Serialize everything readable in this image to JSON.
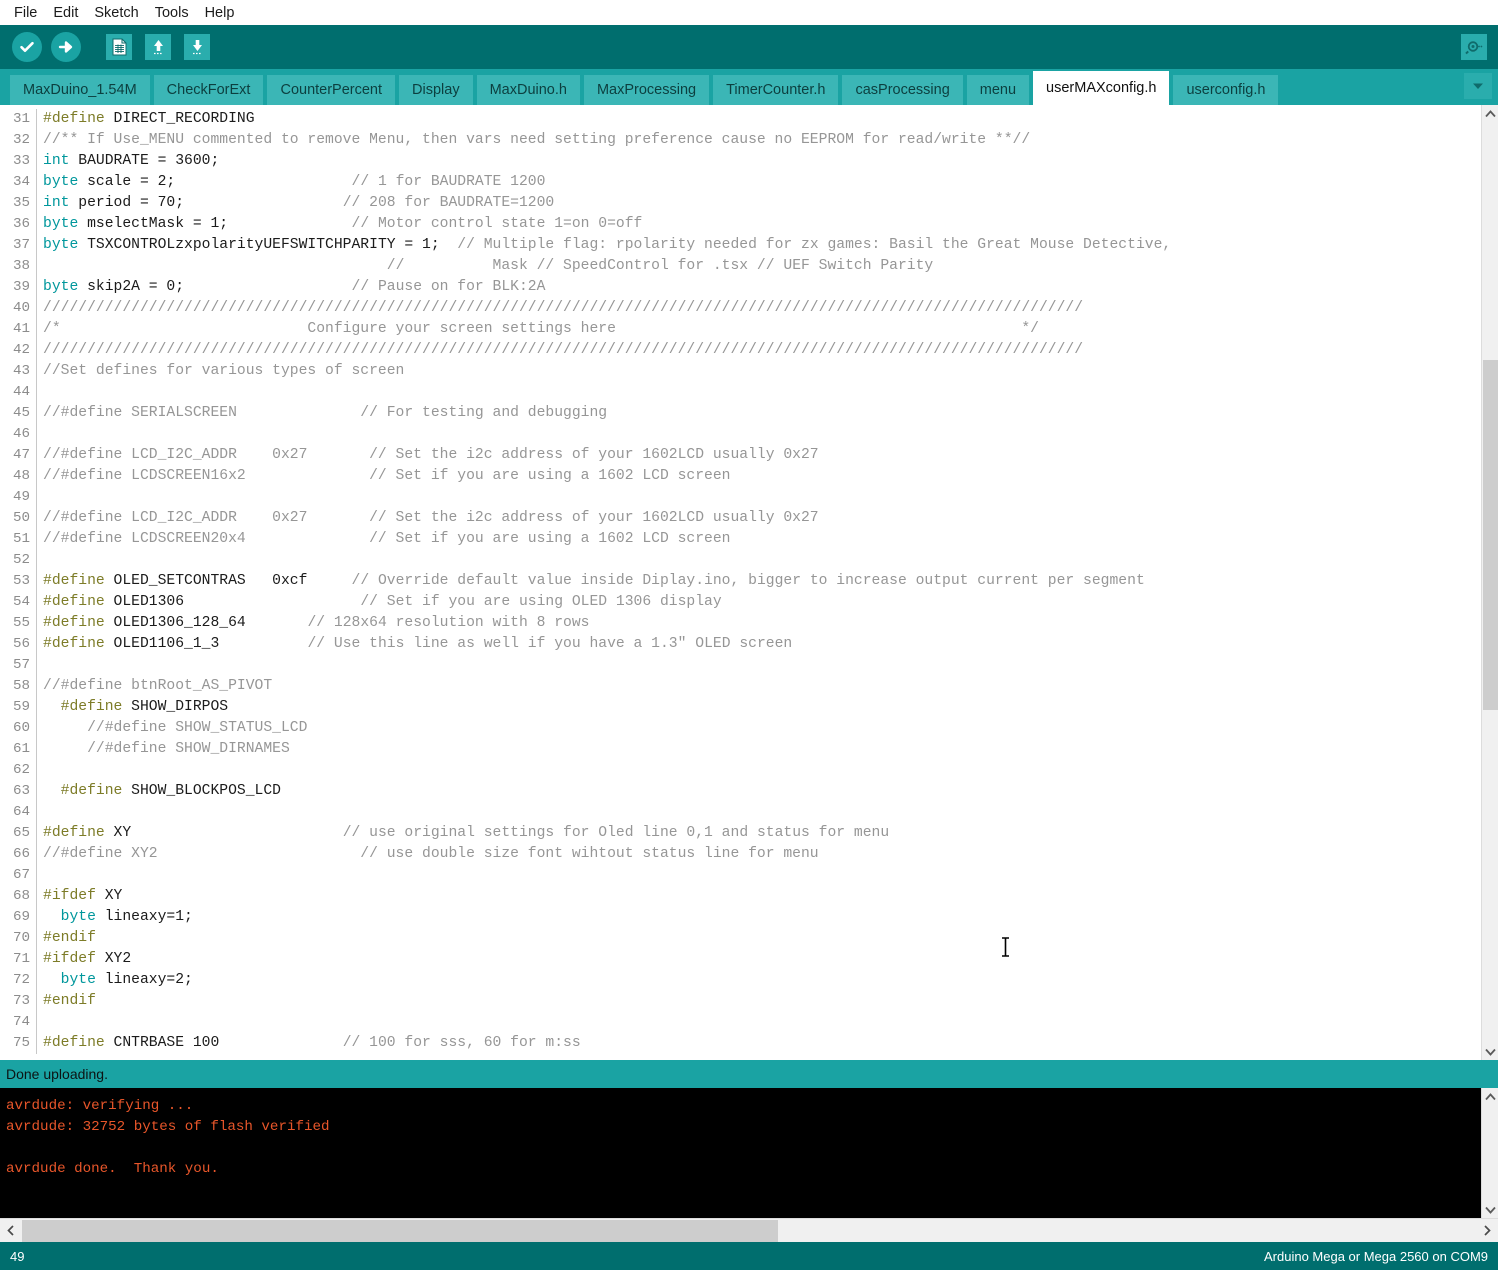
{
  "menu": {
    "items": [
      "File",
      "Edit",
      "Sketch",
      "Tools",
      "Help"
    ]
  },
  "toolbar": {
    "verify_label": "verify-checkmark",
    "upload_label": "upload-arrow",
    "new_label": "new-sketch",
    "open_label": "open-sketch",
    "save_label": "save-sketch",
    "serial_monitor_label": "serial-monitor"
  },
  "tabs": {
    "items": [
      {
        "label": "MaxDuino_1.54M",
        "active": false
      },
      {
        "label": "CheckForExt",
        "active": false
      },
      {
        "label": "CounterPercent",
        "active": false
      },
      {
        "label": "Display",
        "active": false
      },
      {
        "label": "MaxDuino.h",
        "active": false
      },
      {
        "label": "MaxProcessing",
        "active": false
      },
      {
        "label": "TimerCounter.h",
        "active": false
      },
      {
        "label": "casProcessing",
        "active": false
      },
      {
        "label": "menu",
        "active": false
      },
      {
        "label": "userMAXconfig.h",
        "active": true
      },
      {
        "label": "userconfig.h",
        "active": false
      }
    ],
    "overflow_icon": "chevron-down-icon"
  },
  "editor": {
    "first_line": 31,
    "lines": [
      {
        "n": 31,
        "spans": [
          {
            "c": "pre",
            "t": "#define"
          },
          {
            "c": "txt",
            "t": " DIRECT_RECORDING"
          }
        ]
      },
      {
        "n": 32,
        "spans": [
          {
            "c": "cmt",
            "t": "//** If Use_MENU commented to remove Menu, then vars need setting preference cause no EEPROM for read/write **//"
          }
        ]
      },
      {
        "n": 33,
        "spans": [
          {
            "c": "kw",
            "t": "int"
          },
          {
            "c": "txt",
            "t": " BAUDRATE = 3600;"
          }
        ]
      },
      {
        "n": 34,
        "spans": [
          {
            "c": "kw",
            "t": "byte"
          },
          {
            "c": "txt",
            "t": " scale = 2;                    "
          },
          {
            "c": "cmt",
            "t": "// 1 for BAUDRATE 1200"
          }
        ]
      },
      {
        "n": 35,
        "spans": [
          {
            "c": "kw",
            "t": "int"
          },
          {
            "c": "txt",
            "t": " period = 70;                  "
          },
          {
            "c": "cmt",
            "t": "// 208 for BAUDRATE=1200"
          }
        ]
      },
      {
        "n": 36,
        "spans": [
          {
            "c": "kw",
            "t": "byte"
          },
          {
            "c": "txt",
            "t": " mselectMask = 1;              "
          },
          {
            "c": "cmt",
            "t": "// Motor control state 1=on 0=off"
          }
        ]
      },
      {
        "n": 37,
        "spans": [
          {
            "c": "kw",
            "t": "byte"
          },
          {
            "c": "txt",
            "t": " TSXCONTROLzxpolarityUEFSWITCHPARITY = 1;  "
          },
          {
            "c": "cmt",
            "t": "// Multiple flag: rpolarity needed for zx games: Basil the Great Mouse Detective,"
          }
        ]
      },
      {
        "n": 38,
        "spans": [
          {
            "c": "txt",
            "t": "                                       "
          },
          {
            "c": "cmt",
            "t": "//          Mask // SpeedControl for .tsx // UEF Switch Parity"
          }
        ]
      },
      {
        "n": 39,
        "spans": [
          {
            "c": "kw",
            "t": "byte"
          },
          {
            "c": "txt",
            "t": " skip2A = 0;                   "
          },
          {
            "c": "cmt",
            "t": "// Pause on for BLK:2A"
          }
        ]
      },
      {
        "n": 40,
        "spans": [
          {
            "c": "cmt",
            "t": "//////////////////////////////////////////////////////////////////////////////////////////////////////////////////////"
          }
        ]
      },
      {
        "n": 41,
        "spans": [
          {
            "c": "cmt",
            "t": "/*                            Configure your screen settings here                                              */"
          }
        ]
      },
      {
        "n": 42,
        "spans": [
          {
            "c": "cmt",
            "t": "//////////////////////////////////////////////////////////////////////////////////////////////////////////////////////"
          }
        ]
      },
      {
        "n": 43,
        "spans": [
          {
            "c": "cmt",
            "t": "//Set defines for various types of screen"
          }
        ]
      },
      {
        "n": 44,
        "spans": []
      },
      {
        "n": 45,
        "spans": [
          {
            "c": "cmt",
            "t": "//#define SERIALSCREEN              // For testing and debugging"
          }
        ]
      },
      {
        "n": 46,
        "spans": []
      },
      {
        "n": 47,
        "spans": [
          {
            "c": "cmt",
            "t": "//#define LCD_I2C_ADDR    0x27       // Set the i2c address of your 1602LCD usually 0x27"
          }
        ]
      },
      {
        "n": 48,
        "spans": [
          {
            "c": "cmt",
            "t": "//#define LCDSCREEN16x2              // Set if you are using a 1602 LCD screen"
          }
        ]
      },
      {
        "n": 49,
        "spans": []
      },
      {
        "n": 50,
        "spans": [
          {
            "c": "cmt",
            "t": "//#define LCD_I2C_ADDR    0x27       // Set the i2c address of your 1602LCD usually 0x27"
          }
        ]
      },
      {
        "n": 51,
        "spans": [
          {
            "c": "cmt",
            "t": "//#define LCDSCREEN20x4              // Set if you are using a 1602 LCD screen"
          }
        ]
      },
      {
        "n": 52,
        "spans": []
      },
      {
        "n": 53,
        "spans": [
          {
            "c": "pre",
            "t": "#define"
          },
          {
            "c": "txt",
            "t": " OLED_SETCONTRAS   0xcf     "
          },
          {
            "c": "cmt",
            "t": "// Override default value inside Diplay.ino, bigger to increase output current per segment"
          }
        ]
      },
      {
        "n": 54,
        "spans": [
          {
            "c": "pre",
            "t": "#define"
          },
          {
            "c": "txt",
            "t": " OLED1306                    "
          },
          {
            "c": "cmt",
            "t": "// Set if you are using OLED 1306 display"
          }
        ]
      },
      {
        "n": 55,
        "spans": [
          {
            "c": "pre",
            "t": "#define"
          },
          {
            "c": "txt",
            "t": " OLED1306_128_64       "
          },
          {
            "c": "cmt",
            "t": "// 128x64 resolution with 8 rows"
          }
        ]
      },
      {
        "n": 56,
        "spans": [
          {
            "c": "pre",
            "t": "#define"
          },
          {
            "c": "txt",
            "t": " OLED1106_1_3          "
          },
          {
            "c": "cmt",
            "t": "// Use this line as well if you have a 1.3\" OLED screen"
          }
        ]
      },
      {
        "n": 57,
        "spans": []
      },
      {
        "n": 58,
        "spans": [
          {
            "c": "cmt",
            "t": "//#define btnRoot_AS_PIVOT"
          }
        ]
      },
      {
        "n": 59,
        "spans": [
          {
            "c": "txt",
            "t": "  "
          },
          {
            "c": "pre",
            "t": "#define"
          },
          {
            "c": "txt",
            "t": " SHOW_DIRPOS"
          }
        ]
      },
      {
        "n": 60,
        "spans": [
          {
            "c": "txt",
            "t": "     "
          },
          {
            "c": "cmt",
            "t": "//#define SHOW_STATUS_LCD"
          }
        ]
      },
      {
        "n": 61,
        "spans": [
          {
            "c": "txt",
            "t": "     "
          },
          {
            "c": "cmt",
            "t": "//#define SHOW_DIRNAMES"
          }
        ]
      },
      {
        "n": 62,
        "spans": []
      },
      {
        "n": 63,
        "spans": [
          {
            "c": "txt",
            "t": "  "
          },
          {
            "c": "pre",
            "t": "#define"
          },
          {
            "c": "txt",
            "t": " SHOW_BLOCKPOS_LCD"
          }
        ]
      },
      {
        "n": 64,
        "spans": []
      },
      {
        "n": 65,
        "spans": [
          {
            "c": "pre",
            "t": "#define"
          },
          {
            "c": "txt",
            "t": " XY                        "
          },
          {
            "c": "cmt",
            "t": "// use original settings for Oled line 0,1 and status for menu"
          }
        ]
      },
      {
        "n": 66,
        "spans": [
          {
            "c": "cmt",
            "t": "//#define XY2                       // use double size font wihtout status line for menu"
          }
        ]
      },
      {
        "n": 67,
        "spans": []
      },
      {
        "n": 68,
        "spans": [
          {
            "c": "pre",
            "t": "#ifdef"
          },
          {
            "c": "txt",
            "t": " XY"
          }
        ]
      },
      {
        "n": 69,
        "spans": [
          {
            "c": "txt",
            "t": "  "
          },
          {
            "c": "kw",
            "t": "byte"
          },
          {
            "c": "txt",
            "t": " lineaxy=1;"
          }
        ]
      },
      {
        "n": 70,
        "spans": [
          {
            "c": "pre",
            "t": "#endif"
          }
        ]
      },
      {
        "n": 71,
        "spans": [
          {
            "c": "pre",
            "t": "#ifdef"
          },
          {
            "c": "txt",
            "t": " XY2"
          }
        ]
      },
      {
        "n": 72,
        "spans": [
          {
            "c": "txt",
            "t": "  "
          },
          {
            "c": "kw",
            "t": "byte"
          },
          {
            "c": "txt",
            "t": " lineaxy=2;"
          }
        ]
      },
      {
        "n": 73,
        "spans": [
          {
            "c": "pre",
            "t": "#endif"
          }
        ]
      },
      {
        "n": 74,
        "spans": []
      },
      {
        "n": 75,
        "spans": [
          {
            "c": "pre",
            "t": "#define"
          },
          {
            "c": "txt",
            "t": " CNTRBASE 100              "
          },
          {
            "c": "cmt",
            "t": "// 100 for sss, 60 for m:ss"
          }
        ]
      }
    ]
  },
  "status": {
    "message": "Done uploading."
  },
  "console": {
    "lines": [
      "avrdude: verifying ...",
      "avrdude: 32752 bytes of flash verified",
      "",
      "avrdude done.  Thank you."
    ]
  },
  "bottom": {
    "line_number": "49",
    "board_info": "Arduino Mega or Mega 2560 on COM9"
  },
  "colors": {
    "teal_dark": "#006e6e",
    "teal": "#1aa3a3",
    "tab_bg": "#3bb6b6",
    "console_text": "#e8562a",
    "keyword": "#00979c",
    "preprocessor": "#7d7c28",
    "comment": "#969696"
  }
}
